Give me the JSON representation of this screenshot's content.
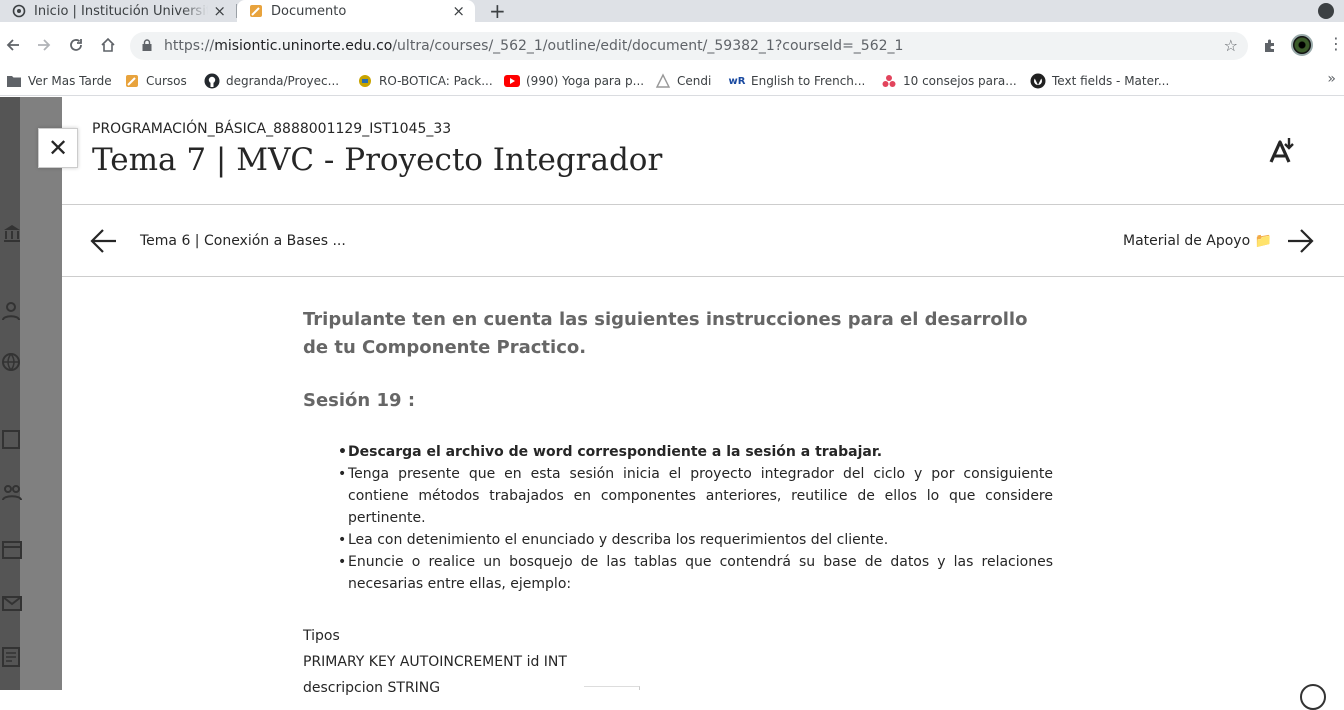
{
  "browser": {
    "tabs": [
      {
        "title": "Inicio | Institución Universitaria",
        "icon": "ring-icon",
        "close": "×"
      },
      {
        "title": "Documento",
        "icon": "pencil-doc-icon",
        "close": "×"
      }
    ],
    "new_tab": "+",
    "url_prefix": "https://",
    "url_domain": "misiontic.uninorte.edu.co",
    "url_path": "/ultra/courses/_562_1/outline/edit/document/_59382_1?courseId=_562_1",
    "bookmarks": [
      {
        "label": "Ver Mas Tarde",
        "icon": "folder-icon"
      },
      {
        "label": "Cursos",
        "icon": "pencil-doc-icon"
      },
      {
        "label": "degranda/Proyec...",
        "icon": "github-icon"
      },
      {
        "label": "RO-BOTICA: Pack...",
        "icon": "robot-icon"
      },
      {
        "label": "(990) Yoga para p...",
        "icon": "youtube-icon"
      },
      {
        "label": "Cendi",
        "icon": "cendi-icon"
      },
      {
        "label": "English to French...",
        "icon": "wordref-icon"
      },
      {
        "label": "10 consejos para...",
        "icon": "dots-icon"
      },
      {
        "label": "Text fields - Mater...",
        "icon": "material-icon"
      }
    ],
    "bookmarks_more": "»"
  },
  "panel": {
    "course_code": "PROGRAMACIÓN_BÁSICA_8888001129_IST1045_33",
    "title": "Tema 7 | MVC - Proyecto Integrador",
    "close_symbol": "✕",
    "prev_label": "Tema 6 | Conexión a Bases ...",
    "next_label": "Material de Apoyo 📁"
  },
  "content": {
    "intro": "Tripulante ten en cuenta las siguientes instrucciones para el desarrollo de tu Componente Practico.",
    "session": "Sesión 19 :",
    "bullets": [
      "Descarga el archivo de word correspondiente a la sesión a trabajar.",
      "Tenga presente que en esta sesión inicia el proyecto integrador del ciclo y por consiguiente contiene métodos trabajados en componentes anteriores, reutilice de ellos lo que considere pertinente.",
      "Lea con detenimiento el enunciado y describa los requerimientos del cliente.",
      "Enuncie o realice un bosquejo de las tablas que contendrá su base de datos y las relaciones necesarias entre ellas, ejemplo:"
    ],
    "lines": [
      "Tipos",
      "PRIMARY KEY AUTOINCREMENT id INT",
      "descripcion STRING"
    ]
  }
}
